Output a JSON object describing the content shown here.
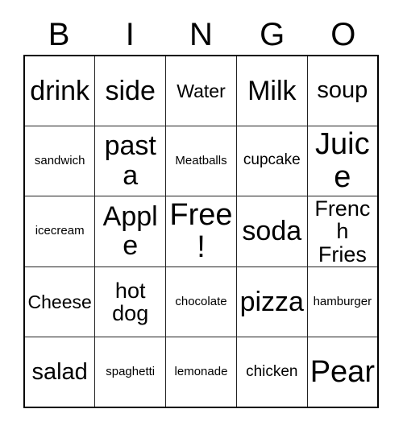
{
  "card": {
    "title_letters": [
      "B",
      "I",
      "N",
      "G",
      "O"
    ],
    "colors": {
      "background": "#ffffff",
      "text": "#000000",
      "outer_border": "#000000",
      "cell_border": "#222222"
    },
    "rows": [
      [
        {
          "label": "drink",
          "size": "lg"
        },
        {
          "label": "side",
          "size": "lg"
        },
        {
          "label": "Water",
          "size": "sm"
        },
        {
          "label": "Milk",
          "size": "lg"
        },
        {
          "label": "soup",
          "size": "md"
        }
      ],
      [
        {
          "label": "sandwich",
          "size": "xxs"
        },
        {
          "label": "pasta",
          "size": "lg"
        },
        {
          "label": "Meatballs",
          "size": "xxs"
        },
        {
          "label": "cupcake",
          "size": "xs"
        },
        {
          "label": "Juice",
          "size": "xl"
        }
      ],
      [
        {
          "label": "icecream",
          "size": "xxs"
        },
        {
          "label": "Apple",
          "size": "lg"
        },
        {
          "label": "Free!",
          "size": "xl"
        },
        {
          "label": "soda",
          "size": "lg"
        },
        {
          "label": "French Fries",
          "size": "wrap"
        }
      ],
      [
        {
          "label": "Cheese",
          "size": "sm"
        },
        {
          "label": "hot dog",
          "size": "wrap"
        },
        {
          "label": "chocolate",
          "size": "xxs"
        },
        {
          "label": "pizza",
          "size": "lg"
        },
        {
          "label": "hamburger",
          "size": "xxs"
        }
      ],
      [
        {
          "label": "salad",
          "size": "md"
        },
        {
          "label": "spaghetti",
          "size": "xxs"
        },
        {
          "label": "lemonade",
          "size": "xxs"
        },
        {
          "label": "chicken",
          "size": "xs"
        },
        {
          "label": "Pear",
          "size": "xl"
        }
      ]
    ]
  }
}
